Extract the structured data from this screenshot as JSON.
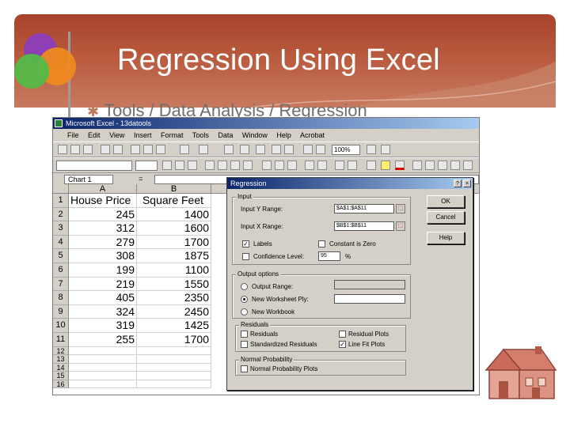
{
  "slide": {
    "title": "Regression Using Excel",
    "bullet": "Tools / Data Analysis / Regression",
    "colors": {
      "banner": "#b0503a",
      "title_text": "#ffffff",
      "bullet_star": "#c0765a"
    }
  },
  "excel": {
    "window_title": "Microsoft Excel - 13datools",
    "menu": [
      "File",
      "Edit",
      "View",
      "Insert",
      "Format",
      "Tools",
      "Data",
      "Window",
      "Help",
      "Acrobat"
    ],
    "zoom": "100%",
    "name_box": "Chart 1",
    "fx_label": "=",
    "columns": [
      "A",
      "B"
    ],
    "rows": [
      {
        "n": "1",
        "a": "House Price",
        "b": "Square Feet"
      },
      {
        "n": "2",
        "a": "245",
        "b": "1400"
      },
      {
        "n": "3",
        "a": "312",
        "b": "1600"
      },
      {
        "n": "4",
        "a": "279",
        "b": "1700"
      },
      {
        "n": "5",
        "a": "308",
        "b": "1875"
      },
      {
        "n": "6",
        "a": "199",
        "b": "1100"
      },
      {
        "n": "7",
        "a": "219",
        "b": "1550"
      },
      {
        "n": "8",
        "a": "405",
        "b": "2350"
      },
      {
        "n": "9",
        "a": "324",
        "b": "2450"
      },
      {
        "n": "10",
        "a": "319",
        "b": "1425"
      },
      {
        "n": "11",
        "a": "255",
        "b": "1700"
      },
      {
        "n": "12",
        "a": "",
        "b": ""
      },
      {
        "n": "13",
        "a": "",
        "b": ""
      },
      {
        "n": "14",
        "a": "",
        "b": ""
      },
      {
        "n": "15",
        "a": "",
        "b": ""
      },
      {
        "n": "16",
        "a": "",
        "b": ""
      }
    ]
  },
  "dialog": {
    "title": "Regression",
    "input_group": "Input",
    "input_y_label": "Input Y Range:",
    "input_y_value": "$A$1:$A$11",
    "input_x_label": "Input X Range:",
    "input_x_value": "$B$1:$B$11",
    "labels_label": "Labels",
    "labels_checked": true,
    "constant_zero_label": "Constant is Zero",
    "constant_zero_checked": false,
    "confidence_label": "Confidence Level:",
    "confidence_value": "95",
    "percent_sign": "%",
    "output_group": "Output options",
    "output_range_label": "Output Range:",
    "new_ws_ply_label": "New Worksheet Ply:",
    "new_workbook_label": "New Workbook",
    "residuals_group": "Residuals",
    "residuals_label": "Residuals",
    "residual_plots_label": "Residual Plots",
    "std_residuals_label": "Standardized Residuals",
    "line_fit_label": "Line Fit Plots",
    "line_fit_checked": true,
    "normal_group": "Normal Probability",
    "normal_plots_label": "Normal Probability Plots",
    "ok_label": "OK",
    "cancel_label": "Cancel",
    "help_label": "Help",
    "close_label": "×",
    "help_q_label": "?",
    "check_mark": "✓"
  }
}
